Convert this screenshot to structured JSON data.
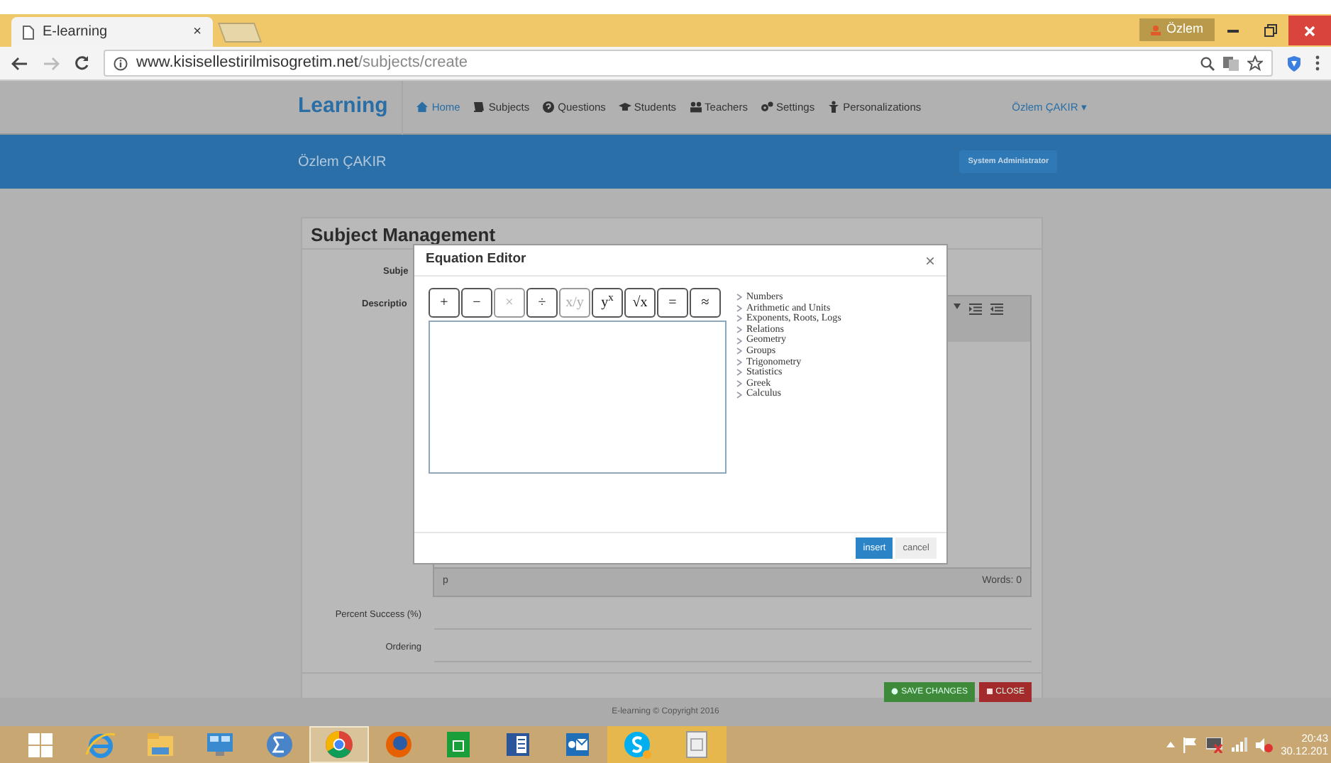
{
  "browser": {
    "tab_title": "E-learning",
    "tab_close": "×",
    "profile": "Özlem",
    "url_host": "www.kisisellestirilmisogretim.net",
    "url_path": "/subjects/create"
  },
  "navbar": {
    "brand": "Learning",
    "user": "Özlem ÇAKIR ▾",
    "items": [
      {
        "label": "Home",
        "kind": "home",
        "selected": true
      },
      {
        "label": "Subjects",
        "kind": "book",
        "selected": false
      },
      {
        "label": "Questions",
        "kind": "question",
        "selected": false
      },
      {
        "label": "Students",
        "kind": "cap",
        "selected": false
      },
      {
        "label": "Teachers",
        "kind": "users",
        "selected": false
      },
      {
        "label": "Settings",
        "kind": "gears",
        "selected": false
      },
      {
        "label": "Personalizations",
        "kind": "figure",
        "selected": false
      }
    ]
  },
  "banner": {
    "name": "Özlem ÇAKIR",
    "role": "System Administrator"
  },
  "card": {
    "title": "Subject Management",
    "subject_label": "Subje",
    "description_label": "Descriptio",
    "editor_path": "p",
    "editor_words": "Words: 0",
    "percent_label": "Percent Success (%)",
    "ordering_label": "Ordering",
    "buttons": [
      {
        "label": "SAVE CHANGES",
        "kind": "save"
      },
      {
        "label": "CLOSE",
        "kind": "close"
      }
    ]
  },
  "footer": "E-learning © Copyright 2016",
  "modal": {
    "title": "Equation Editor",
    "close": "×",
    "symbols": [
      {
        "label": "+",
        "disabled": false
      },
      {
        "label": "−",
        "disabled": false
      },
      {
        "label": "×",
        "disabled": true
      },
      {
        "label": "÷",
        "disabled": false
      },
      {
        "label": "x/y",
        "disabled": true
      },
      {
        "label": "y$^{x}$",
        "disabled": false
      },
      {
        "label": "√x",
        "disabled": false
      },
      {
        "label": "=",
        "disabled": false
      },
      {
        "label": "≈",
        "disabled": false
      }
    ],
    "categories": [
      "Numbers",
      "Arithmetic and Units",
      "Exponents, Roots, Logs",
      "Relations",
      "Geometry",
      "Groups",
      "Trigonometry",
      "Statistics",
      "Greek",
      "Calculus"
    ],
    "buttons": [
      {
        "label": "insert",
        "kind": "primary"
      },
      {
        "label": "cancel",
        "kind": "secondary"
      }
    ]
  },
  "taskbar": {
    "apps": [
      {
        "kind": "start",
        "selected": false,
        "flashing": false
      },
      {
        "kind": "ie",
        "selected": false,
        "flashing": false
      },
      {
        "kind": "folder",
        "selected": false,
        "flashing": false
      },
      {
        "kind": "monitor",
        "selected": false,
        "flashing": false
      },
      {
        "kind": "sigma",
        "selected": false,
        "flashing": false
      },
      {
        "kind": "chrome",
        "selected": true,
        "flashing": false
      },
      {
        "kind": "firefox",
        "selected": false,
        "flashing": false
      },
      {
        "kind": "store",
        "selected": false,
        "flashing": false
      },
      {
        "kind": "word",
        "selected": false,
        "flashing": false
      },
      {
        "kind": "outlook",
        "selected": false,
        "flashing": false
      },
      {
        "kind": "skype",
        "selected": false,
        "flashing": true
      },
      {
        "kind": "document",
        "selected": false,
        "flashing": true
      }
    ],
    "time": "20:43",
    "date": "30.12.201"
  }
}
